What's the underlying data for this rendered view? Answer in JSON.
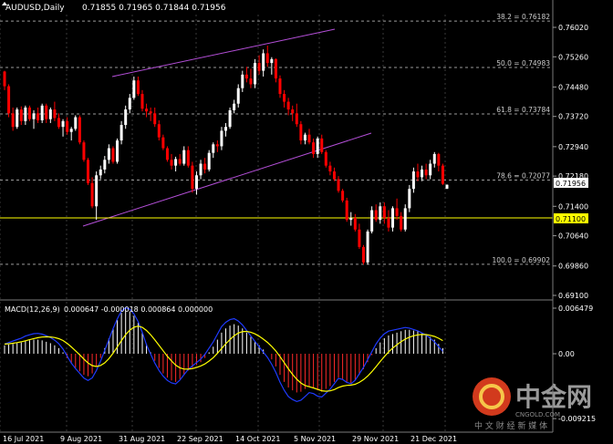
{
  "window": {
    "symbol_title": "AUDUSD,Daily",
    "ohlc": "0.71855 0.71965 0.71844 0.71956"
  },
  "macd": {
    "label": "MACD(12,26,9)",
    "values": "0.000647 -0.000018 0.000864 0.000000"
  },
  "price_axis": {
    "ticks": [
      "0.76020",
      "0.75260",
      "0.74480",
      "0.73720",
      "0.72940",
      "0.72180",
      "0.71400",
      "0.70640",
      "0.69860",
      "0.69100"
    ],
    "current_price": "0.71956",
    "level_price": "0.71100"
  },
  "macd_axis": {
    "ticks": [
      "0.006479",
      "0.00",
      "-0.009215"
    ]
  },
  "time_axis": {
    "labels": [
      "16 Jul 2021",
      "9 Aug 2021",
      "31 Aug 2021",
      "22 Sep 2021",
      "14 Oct 2021",
      "5 Nov 2021",
      "29 Nov 2021",
      "21 Dec 2021"
    ]
  },
  "fib_levels": [
    {
      "label": "38.2 = 0.76182",
      "price": 0.76182
    },
    {
      "label": "50.0 = 0.74983",
      "price": 0.74983
    },
    {
      "label": "61.8 = 0.73784",
      "price": 0.73784
    },
    {
      "label": "78.6 = 0.72077",
      "price": 0.72077
    },
    {
      "label": "100.0 = 0.69902",
      "price": 0.69902
    }
  ],
  "watermark": {
    "brand": "中金网",
    "domain": "CNGOLD.COM",
    "slogan": "中 文 财 经 新 媒 体"
  },
  "colors": {
    "bull": "#ffffff",
    "bear": "#ff0000",
    "channel": "#b44fd8",
    "signal": "#ffff00",
    "macd_line": "#1f3bff",
    "level_line": "#ffff00",
    "grid": "#7a7a7a"
  },
  "chart_data": {
    "type": "candlestick",
    "title": "AUDUSD,Daily",
    "ylim": [
      0.6896,
      0.7648
    ],
    "candles": [
      [
        0.7488,
        0.749,
        0.744,
        0.745
      ],
      [
        0.745,
        0.7455,
        0.737,
        0.738
      ],
      [
        0.738,
        0.7395,
        0.7335,
        0.7345
      ],
      [
        0.7345,
        0.7395,
        0.734,
        0.739
      ],
      [
        0.739,
        0.7398,
        0.735,
        0.736
      ],
      [
        0.736,
        0.74,
        0.735,
        0.7395
      ],
      [
        0.7395,
        0.74,
        0.736,
        0.7365
      ],
      [
        0.7365,
        0.7388,
        0.734,
        0.738
      ],
      [
        0.738,
        0.7395,
        0.7355,
        0.7362
      ],
      [
        0.7362,
        0.7405,
        0.7355,
        0.74
      ],
      [
        0.74,
        0.7405,
        0.7355,
        0.7365
      ],
      [
        0.7365,
        0.7395,
        0.7355,
        0.739
      ],
      [
        0.739,
        0.741,
        0.736,
        0.7368
      ],
      [
        0.7368,
        0.738,
        0.734,
        0.7345
      ],
      [
        0.7345,
        0.7365,
        0.732,
        0.736
      ],
      [
        0.736,
        0.737,
        0.7325,
        0.7332
      ],
      [
        0.7332,
        0.7345,
        0.731,
        0.734
      ],
      [
        0.734,
        0.7375,
        0.7335,
        0.737
      ],
      [
        0.737,
        0.7375,
        0.73,
        0.7305
      ],
      [
        0.7305,
        0.731,
        0.7255,
        0.726
      ],
      [
        0.726,
        0.7265,
        0.7195,
        0.72
      ],
      [
        0.72,
        0.7215,
        0.7135,
        0.714
      ],
      [
        0.714,
        0.723,
        0.7105,
        0.722
      ],
      [
        0.722,
        0.7245,
        0.721,
        0.7235
      ],
      [
        0.7235,
        0.727,
        0.7225,
        0.726
      ],
      [
        0.726,
        0.73,
        0.725,
        0.729
      ],
      [
        0.729,
        0.7295,
        0.725,
        0.7255
      ],
      [
        0.7255,
        0.7315,
        0.725,
        0.731
      ],
      [
        0.731,
        0.736,
        0.73,
        0.735
      ],
      [
        0.735,
        0.74,
        0.734,
        0.739
      ],
      [
        0.739,
        0.743,
        0.738,
        0.742
      ],
      [
        0.742,
        0.7475,
        0.7415,
        0.7465
      ],
      [
        0.7465,
        0.7475,
        0.7425,
        0.743
      ],
      [
        0.743,
        0.744,
        0.7385,
        0.7392
      ],
      [
        0.7392,
        0.7405,
        0.737,
        0.7385
      ],
      [
        0.7385,
        0.7395,
        0.736,
        0.738
      ],
      [
        0.738,
        0.7395,
        0.7345,
        0.7352
      ],
      [
        0.7352,
        0.7362,
        0.731,
        0.7318
      ],
      [
        0.7318,
        0.7325,
        0.7285,
        0.729
      ],
      [
        0.729,
        0.7295,
        0.7255,
        0.726
      ],
      [
        0.726,
        0.7275,
        0.7235,
        0.7245
      ],
      [
        0.7245,
        0.7268,
        0.723,
        0.7262
      ],
      [
        0.7262,
        0.7275,
        0.7245,
        0.725
      ],
      [
        0.725,
        0.7295,
        0.7245,
        0.7285
      ],
      [
        0.7285,
        0.7295,
        0.724,
        0.7245
      ],
      [
        0.7245,
        0.7255,
        0.7175,
        0.7185
      ],
      [
        0.7185,
        0.723,
        0.717,
        0.722
      ],
      [
        0.722,
        0.726,
        0.721,
        0.725
      ],
      [
        0.725,
        0.7265,
        0.7225,
        0.7235
      ],
      [
        0.7235,
        0.7285,
        0.723,
        0.7278
      ],
      [
        0.7278,
        0.7305,
        0.7265,
        0.73
      ],
      [
        0.73,
        0.731,
        0.728,
        0.7295
      ],
      [
        0.7295,
        0.7345,
        0.7285,
        0.7335
      ],
      [
        0.7335,
        0.7355,
        0.732,
        0.7345
      ],
      [
        0.7345,
        0.7395,
        0.734,
        0.7388
      ],
      [
        0.7388,
        0.7415,
        0.738,
        0.7405
      ],
      [
        0.7405,
        0.7455,
        0.7395,
        0.7445
      ],
      [
        0.7445,
        0.749,
        0.7435,
        0.748
      ],
      [
        0.748,
        0.75,
        0.746,
        0.747
      ],
      [
        0.747,
        0.7495,
        0.7445,
        0.7455
      ],
      [
        0.7455,
        0.752,
        0.7445,
        0.751
      ],
      [
        0.751,
        0.753,
        0.748,
        0.749
      ],
      [
        0.749,
        0.7545,
        0.7475,
        0.7535
      ],
      [
        0.7535,
        0.7555,
        0.75,
        0.751
      ],
      [
        0.751,
        0.7525,
        0.748,
        0.752
      ],
      [
        0.752,
        0.7522,
        0.746,
        0.747
      ],
      [
        0.747,
        0.7478,
        0.742,
        0.743
      ],
      [
        0.743,
        0.744,
        0.7395,
        0.741
      ],
      [
        0.741,
        0.742,
        0.7375,
        0.739
      ],
      [
        0.739,
        0.74,
        0.736,
        0.738
      ],
      [
        0.738,
        0.7405,
        0.7345,
        0.7352
      ],
      [
        0.7352,
        0.736,
        0.73,
        0.731
      ],
      [
        0.731,
        0.733,
        0.73,
        0.7325
      ],
      [
        0.7325,
        0.734,
        0.73,
        0.7305
      ],
      [
        0.7305,
        0.7315,
        0.7265,
        0.7275
      ],
      [
        0.7275,
        0.732,
        0.7265,
        0.7315
      ],
      [
        0.7315,
        0.7325,
        0.7275,
        0.728
      ],
      [
        0.728,
        0.7285,
        0.724,
        0.7245
      ],
      [
        0.7245,
        0.7255,
        0.722,
        0.723
      ],
      [
        0.723,
        0.724,
        0.7205,
        0.721
      ],
      [
        0.721,
        0.7218,
        0.7175,
        0.718
      ],
      [
        0.718,
        0.7185,
        0.715,
        0.7155
      ],
      [
        0.7155,
        0.7162,
        0.71,
        0.7105
      ],
      [
        0.7105,
        0.7125,
        0.709,
        0.711
      ],
      [
        0.711,
        0.712,
        0.7075,
        0.708
      ],
      [
        0.708,
        0.7095,
        0.703,
        0.7035
      ],
      [
        0.7035,
        0.704,
        0.699,
        0.6995
      ],
      [
        0.6995,
        0.708,
        0.699,
        0.7075
      ],
      [
        0.7075,
        0.714,
        0.707,
        0.713
      ],
      [
        0.713,
        0.7145,
        0.71,
        0.7105
      ],
      [
        0.7105,
        0.715,
        0.7095,
        0.714
      ],
      [
        0.714,
        0.715,
        0.7095,
        0.711
      ],
      [
        0.711,
        0.713,
        0.7075,
        0.7085
      ],
      [
        0.7085,
        0.714,
        0.7075,
        0.7135
      ],
      [
        0.7135,
        0.716,
        0.7105,
        0.7115
      ],
      [
        0.7115,
        0.7125,
        0.7075,
        0.708
      ],
      [
        0.708,
        0.7145,
        0.7075,
        0.7135
      ],
      [
        0.7135,
        0.7195,
        0.7125,
        0.7185
      ],
      [
        0.7185,
        0.724,
        0.7175,
        0.723
      ],
      [
        0.723,
        0.725,
        0.7205,
        0.7215
      ],
      [
        0.7215,
        0.7245,
        0.7205,
        0.7235
      ],
      [
        0.7235,
        0.725,
        0.721,
        0.722
      ],
      [
        0.722,
        0.726,
        0.721,
        0.725
      ],
      [
        0.725,
        0.728,
        0.724,
        0.7275
      ],
      [
        0.7275,
        0.7278,
        0.723,
        0.7245
      ],
      [
        0.7245,
        0.725,
        0.7195,
        0.7198
      ],
      [
        0.71855,
        0.71965,
        0.71844,
        0.71956
      ]
    ],
    "macd_histogram": [
      0.0012,
      0.0013,
      0.0014,
      0.0015,
      0.0016,
      0.0018,
      0.0019,
      0.002,
      0.002,
      0.0019,
      0.0017,
      0.0015,
      0.0012,
      0.0008,
      0.0002,
      -0.0006,
      -0.0014,
      -0.002,
      -0.0025,
      -0.003,
      -0.0032,
      -0.0028,
      -0.0018,
      -0.0006,
      0.0008,
      0.0022,
      0.0036,
      0.0048,
      0.0058,
      0.0062,
      0.006,
      0.0054,
      0.0044,
      0.003,
      0.0014,
      0.0002,
      -0.001,
      -0.002,
      -0.0028,
      -0.0034,
      -0.0038,
      -0.004,
      -0.0036,
      -0.003,
      -0.0024,
      -0.002,
      -0.0016,
      -0.0012,
      -0.0006,
      0.0002,
      0.001,
      0.002,
      0.003,
      0.0036,
      0.004,
      0.0042,
      0.004,
      0.0036,
      0.003,
      0.0024,
      0.0018,
      0.0012,
      0.0006,
      0.0,
      -0.0008,
      -0.0018,
      -0.003,
      -0.004,
      -0.0048,
      -0.0052,
      -0.0055,
      -0.0054,
      -0.005,
      -0.0046,
      -0.0048,
      -0.0052,
      -0.0054,
      -0.005,
      -0.0046,
      -0.004,
      -0.0034,
      -0.0036,
      -0.004,
      -0.0042,
      -0.0038,
      -0.003,
      -0.0022,
      -0.0012,
      -0.0002,
      0.0008,
      0.0016,
      0.0022,
      0.0026,
      0.0028,
      0.003,
      0.0032,
      0.0034,
      0.0034,
      0.0033,
      0.0032,
      0.003,
      0.0028,
      0.0024,
      0.002,
      0.0014,
      0.0008
    ]
  }
}
